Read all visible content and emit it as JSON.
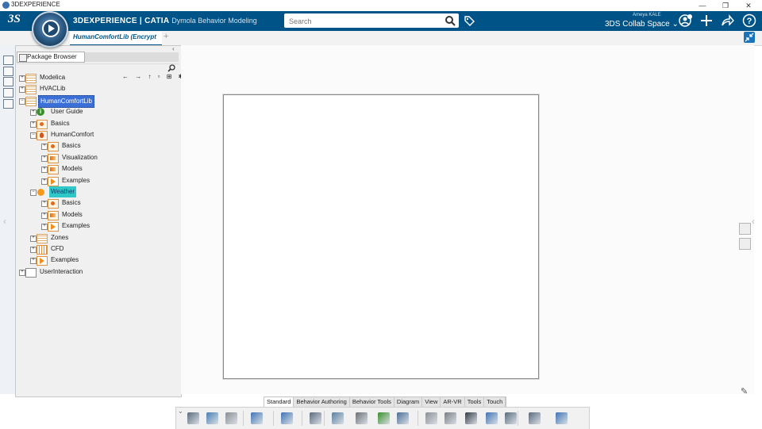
{
  "os_window": {
    "title": "3DEXPERIENCE",
    "minimize": "—",
    "restore": "❐",
    "close": "✕"
  },
  "top_bar": {
    "logo": "3S",
    "brand_main": "3DEXPERIENCE | CATIA",
    "brand_app": "Dymola Behavior Modeling",
    "search_placeholder": "Search",
    "user_name": "Ameya KALE",
    "collab_space": "3DS Collab Space ⌄",
    "icons": [
      "search-icon",
      "tag-icon",
      "user-icon",
      "add-icon",
      "share-icon",
      "help-icon"
    ]
  },
  "tabs": {
    "active_label": "HumanComfortLib (Encrypt",
    "add_label": "+"
  },
  "package_browser": {
    "tab_label": "Package Browser",
    "collapse_glyph": "‹",
    "nav_glyphs": "← → ↑ ▫ ⊞ ✱",
    "tree": [
      {
        "label": "Modelica",
        "depth": 0,
        "expander": "+",
        "icon": "book"
      },
      {
        "label": "HVACLib",
        "depth": 0,
        "expander": "+",
        "icon": "book"
      },
      {
        "label": "HumanComfortLib",
        "depth": 0,
        "expander": "−",
        "icon": "book",
        "selected": "blue"
      },
      {
        "label": "User Guide",
        "depth": 1,
        "expander": "+",
        "icon": "info"
      },
      {
        "label": "Basics",
        "depth": 1,
        "expander": "+",
        "icon": "orange"
      },
      {
        "label": "HumanComfort",
        "depth": 1,
        "expander": "−",
        "icon": "fire"
      },
      {
        "label": "Basics",
        "depth": 2,
        "expander": "+",
        "icon": "orange"
      },
      {
        "label": "Visualization",
        "depth": 2,
        "expander": "+",
        "icon": "vis"
      },
      {
        "label": "Models",
        "depth": 2,
        "expander": "+",
        "icon": "vis"
      },
      {
        "label": "Examples",
        "depth": 2,
        "expander": "+",
        "icon": "play-ico"
      },
      {
        "label": "Weather",
        "depth": 1,
        "expander": "−",
        "icon": "dot",
        "selected": "teal"
      },
      {
        "label": "Basics",
        "depth": 2,
        "expander": "+",
        "icon": "orange"
      },
      {
        "label": "Models",
        "depth": 2,
        "expander": "+",
        "icon": "vis"
      },
      {
        "label": "Examples",
        "depth": 2,
        "expander": "+",
        "icon": "play-ico"
      },
      {
        "label": "Zones",
        "depth": 1,
        "expander": "+",
        "icon": "book"
      },
      {
        "label": "CFD",
        "depth": 1,
        "expander": "+",
        "icon": "grid"
      },
      {
        "label": "Examples",
        "depth": 1,
        "expander": "+",
        "icon": "play-ico"
      },
      {
        "label": "UserInteraction",
        "depth": 0,
        "expander": "+",
        "icon": "plain"
      }
    ]
  },
  "canvas": {
    "left_arrow": "‹",
    "right_arrow": "‹",
    "pen_glyph": "✎"
  },
  "bottom_tabs": [
    "Standard",
    "Behavior Authoring",
    "Behavior Tools",
    "Diagram",
    "View",
    "AR-VR",
    "Tools",
    "Touch"
  ],
  "bottom_active_tab": "Standard",
  "toolbar_icons": [
    "cut-icon",
    "copy-icon",
    "paste-icon",
    "undo-icon",
    "update-icon",
    "export-icon",
    "simulate-icon",
    "check-icon",
    "info-icon",
    "connect-icon",
    "box-icon",
    "align-icon",
    "apply-icon",
    "layer-icon",
    "percent-icon",
    "sequence-icon",
    "refresh-icon"
  ],
  "colors": {
    "top_bar": "#005386",
    "selection_blue": "#3b6fd8",
    "selection_teal": "#2ec8c8"
  }
}
